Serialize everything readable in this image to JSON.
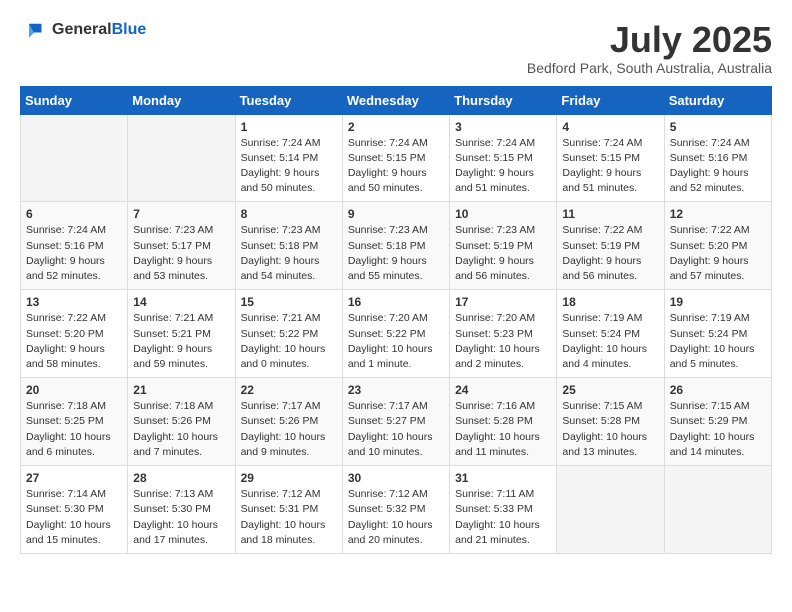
{
  "logo": {
    "text_general": "General",
    "text_blue": "Blue"
  },
  "title": {
    "month": "July 2025",
    "location": "Bedford Park, South Australia, Australia"
  },
  "calendar": {
    "headers": [
      "Sunday",
      "Monday",
      "Tuesday",
      "Wednesday",
      "Thursday",
      "Friday",
      "Saturday"
    ],
    "weeks": [
      [
        {
          "day": "",
          "info": ""
        },
        {
          "day": "",
          "info": ""
        },
        {
          "day": "1",
          "info": "Sunrise: 7:24 AM\nSunset: 5:14 PM\nDaylight: 9 hours and 50 minutes."
        },
        {
          "day": "2",
          "info": "Sunrise: 7:24 AM\nSunset: 5:15 PM\nDaylight: 9 hours and 50 minutes."
        },
        {
          "day": "3",
          "info": "Sunrise: 7:24 AM\nSunset: 5:15 PM\nDaylight: 9 hours and 51 minutes."
        },
        {
          "day": "4",
          "info": "Sunrise: 7:24 AM\nSunset: 5:15 PM\nDaylight: 9 hours and 51 minutes."
        },
        {
          "day": "5",
          "info": "Sunrise: 7:24 AM\nSunset: 5:16 PM\nDaylight: 9 hours and 52 minutes."
        }
      ],
      [
        {
          "day": "6",
          "info": "Sunrise: 7:24 AM\nSunset: 5:16 PM\nDaylight: 9 hours and 52 minutes."
        },
        {
          "day": "7",
          "info": "Sunrise: 7:23 AM\nSunset: 5:17 PM\nDaylight: 9 hours and 53 minutes."
        },
        {
          "day": "8",
          "info": "Sunrise: 7:23 AM\nSunset: 5:18 PM\nDaylight: 9 hours and 54 minutes."
        },
        {
          "day": "9",
          "info": "Sunrise: 7:23 AM\nSunset: 5:18 PM\nDaylight: 9 hours and 55 minutes."
        },
        {
          "day": "10",
          "info": "Sunrise: 7:23 AM\nSunset: 5:19 PM\nDaylight: 9 hours and 56 minutes."
        },
        {
          "day": "11",
          "info": "Sunrise: 7:22 AM\nSunset: 5:19 PM\nDaylight: 9 hours and 56 minutes."
        },
        {
          "day": "12",
          "info": "Sunrise: 7:22 AM\nSunset: 5:20 PM\nDaylight: 9 hours and 57 minutes."
        }
      ],
      [
        {
          "day": "13",
          "info": "Sunrise: 7:22 AM\nSunset: 5:20 PM\nDaylight: 9 hours and 58 minutes."
        },
        {
          "day": "14",
          "info": "Sunrise: 7:21 AM\nSunset: 5:21 PM\nDaylight: 9 hours and 59 minutes."
        },
        {
          "day": "15",
          "info": "Sunrise: 7:21 AM\nSunset: 5:22 PM\nDaylight: 10 hours and 0 minutes."
        },
        {
          "day": "16",
          "info": "Sunrise: 7:20 AM\nSunset: 5:22 PM\nDaylight: 10 hours and 1 minute."
        },
        {
          "day": "17",
          "info": "Sunrise: 7:20 AM\nSunset: 5:23 PM\nDaylight: 10 hours and 2 minutes."
        },
        {
          "day": "18",
          "info": "Sunrise: 7:19 AM\nSunset: 5:24 PM\nDaylight: 10 hours and 4 minutes."
        },
        {
          "day": "19",
          "info": "Sunrise: 7:19 AM\nSunset: 5:24 PM\nDaylight: 10 hours and 5 minutes."
        }
      ],
      [
        {
          "day": "20",
          "info": "Sunrise: 7:18 AM\nSunset: 5:25 PM\nDaylight: 10 hours and 6 minutes."
        },
        {
          "day": "21",
          "info": "Sunrise: 7:18 AM\nSunset: 5:26 PM\nDaylight: 10 hours and 7 minutes."
        },
        {
          "day": "22",
          "info": "Sunrise: 7:17 AM\nSunset: 5:26 PM\nDaylight: 10 hours and 9 minutes."
        },
        {
          "day": "23",
          "info": "Sunrise: 7:17 AM\nSunset: 5:27 PM\nDaylight: 10 hours and 10 minutes."
        },
        {
          "day": "24",
          "info": "Sunrise: 7:16 AM\nSunset: 5:28 PM\nDaylight: 10 hours and 11 minutes."
        },
        {
          "day": "25",
          "info": "Sunrise: 7:15 AM\nSunset: 5:28 PM\nDaylight: 10 hours and 13 minutes."
        },
        {
          "day": "26",
          "info": "Sunrise: 7:15 AM\nSunset: 5:29 PM\nDaylight: 10 hours and 14 minutes."
        }
      ],
      [
        {
          "day": "27",
          "info": "Sunrise: 7:14 AM\nSunset: 5:30 PM\nDaylight: 10 hours and 15 minutes."
        },
        {
          "day": "28",
          "info": "Sunrise: 7:13 AM\nSunset: 5:30 PM\nDaylight: 10 hours and 17 minutes."
        },
        {
          "day": "29",
          "info": "Sunrise: 7:12 AM\nSunset: 5:31 PM\nDaylight: 10 hours and 18 minutes."
        },
        {
          "day": "30",
          "info": "Sunrise: 7:12 AM\nSunset: 5:32 PM\nDaylight: 10 hours and 20 minutes."
        },
        {
          "day": "31",
          "info": "Sunrise: 7:11 AM\nSunset: 5:33 PM\nDaylight: 10 hours and 21 minutes."
        },
        {
          "day": "",
          "info": ""
        },
        {
          "day": "",
          "info": ""
        }
      ]
    ]
  }
}
